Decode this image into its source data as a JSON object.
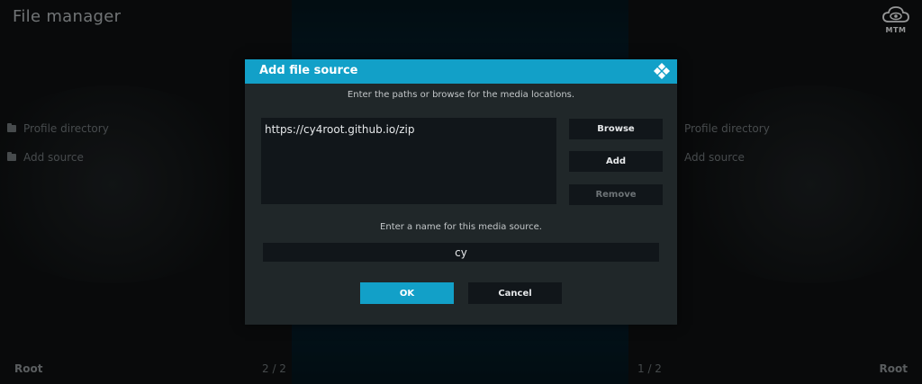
{
  "app": {
    "title": "File manager"
  },
  "badge": {
    "label": "MTM",
    "icon": "cloud-eye-icon"
  },
  "left_panel": {
    "items": [
      {
        "label": "Profile directory",
        "icon": "folder-icon"
      },
      {
        "label": "Add source",
        "icon": "folder-icon"
      }
    ],
    "footer_label": "Root",
    "footer_page": "2 / 2"
  },
  "right_panel": {
    "items": [
      {
        "label": "Profile directory",
        "icon": "folder-icon"
      },
      {
        "label": "Add source",
        "icon": "folder-icon"
      }
    ],
    "footer_label": "Root",
    "footer_page": "1 / 2"
  },
  "dialog": {
    "title": "Add file source",
    "logo_icon": "kodi-logo-icon",
    "paths_hint": "Enter the paths or browse for the media locations.",
    "paths": [
      "https://cy4root.github.io/zip"
    ],
    "browse_label": "Browse",
    "add_label": "Add",
    "remove_label": "Remove",
    "name_hint": "Enter a name for this media source.",
    "name_value": "cy",
    "ok_label": "OK",
    "cancel_label": "Cancel"
  },
  "colors": {
    "accent": "#12a0c8",
    "dialog_bg": "#202729",
    "field_bg": "#11161a"
  }
}
